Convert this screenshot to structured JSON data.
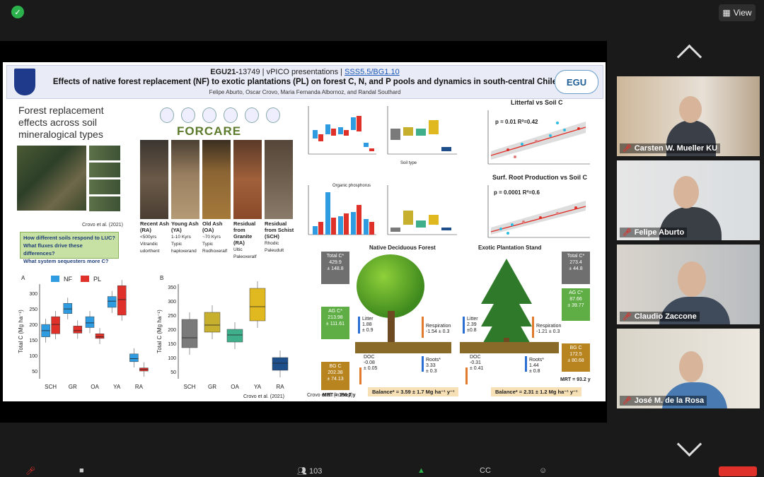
{
  "window": {
    "view_label": "View"
  },
  "slide": {
    "header": {
      "code": "EGU21-",
      "code_num": "13749",
      "sep1": " | ",
      "pico": "vPICO presentations",
      "sep2": " | ",
      "session": "SSS5.5/BG1.10",
      "title": "Effects of native forest replacement (NF) to exotic plantations (PL) on forest C, N, and P pools and dynamics in south-central Chile",
      "authors": "Felipe Aburto, Oscar Crovo, Maria Fernanda Albornoz, and Randal Southard",
      "egu_logo": "EGU"
    },
    "section_title": "Forest replacement effects across soil mineralogical types",
    "map_citation": "Crovo et al. (2021)",
    "questions": [
      "How different soils respond to LUC?",
      "What fluxes drive these differences?",
      "What system sequesters more C?"
    ],
    "forcare": "FORCARE",
    "soils": [
      {
        "name": "Recent Ash (RA)",
        "age": "<500yrs",
        "class": "Vitrandic udorthent"
      },
      {
        "name": "Young Ash (YA)",
        "age": "1-10 Kyrs",
        "class": "Typic haploxerand"
      },
      {
        "name": "Old Ash (OA)",
        "age": "~70 Kyrs",
        "class": "Typic Rodhoxeralf"
      },
      {
        "name": "Residual from Granite (RA)",
        "age": "",
        "class": "Ultic Paleoxeralf"
      },
      {
        "name": "Residual from Schist (SCH)",
        "age": "",
        "class": "Rhodic Paleudult"
      }
    ],
    "charts": {
      "panel_a": "A",
      "panel_b": "B",
      "legend_nf": "NF",
      "legend_pl": "PL",
      "ylabel": "Total C (Mg ha⁻¹)",
      "categories": [
        "SCH",
        "GR",
        "OA",
        "YA",
        "RA"
      ],
      "citation_b": "Crovo et al. (2021)",
      "organic_p": "Organic phosphorus",
      "soil_type": "Soil type",
      "litterfal_title": "Litterfal vs Soil C",
      "litterfal_stats": "p = 0.01  R²=0.42",
      "root_title": "Surf. Root Production  vs Soil C",
      "root_stats": "p = 0.0001 R²=0.6"
    },
    "forest": {
      "native_title": "Native Deciduous Forest",
      "exotic_title": "Exotic Plantation Stand",
      "nf_total": [
        "Total C*",
        "429.9",
        "± 148.8"
      ],
      "nf_ag": [
        "AG C*",
        "213.98",
        "± 111.61"
      ],
      "nf_bg": [
        "BG C",
        "202.38",
        "± 74.13"
      ],
      "nf_mrt": "MRT = 156.7 y",
      "nf_litter": [
        "Litter",
        "1.88",
        "± 0.9"
      ],
      "nf_resp": [
        "Respiration",
        "-1.54 ± 0.3"
      ],
      "nf_roots": [
        "Roots*",
        "3.33",
        "± 0.3"
      ],
      "nf_doc": [
        "DOC",
        "-0.08",
        "± 0.05"
      ],
      "nf_balance": "Balance* = 3.59 ± 1.7 Mg ha⁻¹ y⁻¹",
      "pl_total": [
        "Total C*",
        "273.4",
        "± 44.8"
      ],
      "pl_ag": [
        "AG C*",
        "87.66",
        "± 39.77"
      ],
      "pl_bg": [
        "BG C",
        "172.5",
        "± 80.68"
      ],
      "pl_mrt": "MRT = 93.2 y",
      "pl_litter": [
        "Litter",
        "2.39",
        "±0.8"
      ],
      "pl_resp": [
        "Respiration",
        "-1.21 ± 0.3"
      ],
      "pl_roots": [
        "Roots*",
        "1.44",
        "± 0.8"
      ],
      "pl_doc": [
        "DOC",
        "-0.31",
        "± 0.41"
      ],
      "pl_balance": "Balance* = 2.31 ± 1.2 Mg ha⁻¹ y⁻¹",
      "citation": "Crovo et al. (in Prep)"
    }
  },
  "participants": [
    {
      "name": "Carsten W. Mueller KU",
      "muted": true
    },
    {
      "name": "Felipe Aburto",
      "muted": true
    },
    {
      "name": "Claudio Zaccone",
      "muted": true
    },
    {
      "name": "José M. de la Rosa",
      "muted": true
    }
  ],
  "toolbar": {
    "participants_count": "103"
  },
  "chart_data": [
    {
      "type": "box",
      "title": "A",
      "ylabel": "Total C (Mg ha-1)",
      "categories": [
        "SCH",
        "GR",
        "OA",
        "YA",
        "RA"
      ],
      "series": [
        {
          "name": "NF",
          "color": "#2f9be0",
          "median": [
            180,
            250,
            205,
            275,
            90
          ],
          "q1": [
            160,
            235,
            190,
            255,
            80
          ],
          "q3": [
            200,
            268,
            225,
            290,
            105
          ]
        },
        {
          "name": "PL",
          "color": "#e0302a",
          "median": [
            200,
            180,
            160,
            280,
            55
          ],
          "q1": [
            170,
            172,
            155,
            230,
            50
          ],
          "q3": [
            225,
            195,
            170,
            325,
            60
          ]
        }
      ],
      "ylim": [
        25,
        330
      ]
    },
    {
      "type": "box",
      "title": "B",
      "ylabel": "Total C (Mg ha-1)",
      "categories": [
        "SCH",
        "GR",
        "OA",
        "YA",
        "RA"
      ],
      "median": [
        170,
        215,
        180,
        280,
        80
      ],
      "q1": [
        135,
        190,
        155,
        230,
        55
      ],
      "q3": [
        235,
        260,
        200,
        345,
        100
      ],
      "colors": [
        "#7a7a7a",
        "#c7b02e",
        "#3fae8a",
        "#e0b820",
        "#1f4f8a"
      ]
    }
  ]
}
